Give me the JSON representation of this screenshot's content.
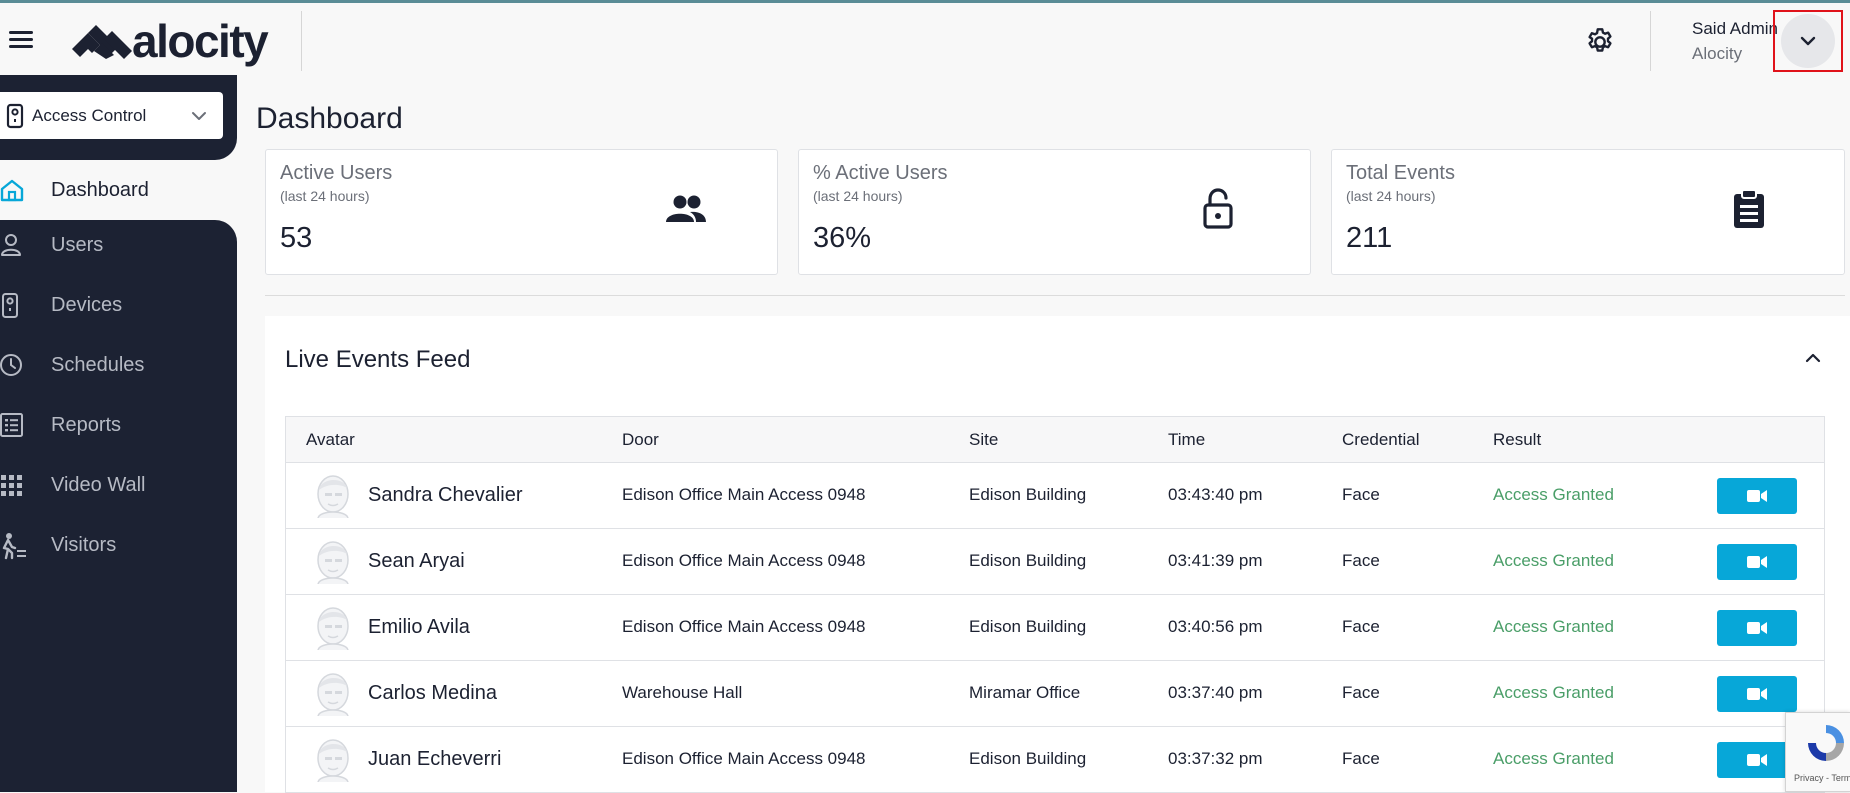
{
  "header": {
    "brand": "alocity",
    "user_name": "Said Admin",
    "user_org": "Alocity",
    "icons": [
      "menu-icon",
      "gear-icon",
      "chevron-down-icon"
    ]
  },
  "sidebar": {
    "module": "Access Control",
    "items": [
      {
        "label": "Dashboard",
        "icon": "home-icon",
        "active": true
      },
      {
        "label": "Users",
        "icon": "user-icon"
      },
      {
        "label": "Devices",
        "icon": "device-icon"
      },
      {
        "label": "Schedules",
        "icon": "clock-icon"
      },
      {
        "label": "Reports",
        "icon": "report-icon"
      },
      {
        "label": "Video Wall",
        "icon": "grid-icon"
      },
      {
        "label": "Visitors",
        "icon": "visitor-icon"
      }
    ]
  },
  "main": {
    "title": "Dashboard",
    "cards": [
      {
        "title": "Active Users",
        "subtitle": "(last 24 hours)",
        "value": "53",
        "icon": "users-icon"
      },
      {
        "title": "% Active Users",
        "subtitle": "(last 24 hours)",
        "value": "36%",
        "icon": "lock-open-icon"
      },
      {
        "title": "Total Events",
        "subtitle": "(last 24 hours)",
        "value": "211",
        "icon": "clipboard-icon"
      }
    ],
    "feed": {
      "title": "Live Events Feed",
      "columns": [
        "Avatar",
        "Door",
        "Site",
        "Time",
        "Credential",
        "Result"
      ],
      "rows": [
        {
          "name": "Sandra Chevalier",
          "door": "Edison Office Main Access 0948",
          "site": "Edison Building",
          "time": "03:43:40 pm",
          "credential": "Face",
          "result": "Access Granted"
        },
        {
          "name": "Sean Aryai",
          "door": "Edison Office Main Access 0948",
          "site": "Edison Building",
          "time": "03:41:39 pm",
          "credential": "Face",
          "result": "Access Granted"
        },
        {
          "name": "Emilio Avila",
          "door": "Edison Office Main Access 0948",
          "site": "Edison Building",
          "time": "03:40:56 pm",
          "credential": "Face",
          "result": "Access Granted"
        },
        {
          "name": "Carlos Medina",
          "door": "Warehouse Hall",
          "site": "Miramar Office",
          "time": "03:37:40 pm",
          "credential": "Face",
          "result": "Access Granted"
        },
        {
          "name": "Juan Echeverri",
          "door": "Edison Office Main Access 0948",
          "site": "Edison Building",
          "time": "03:37:32 pm",
          "credential": "Face",
          "result": "Access Granted"
        }
      ]
    }
  },
  "recaptcha": {
    "text": "Privacy - Terms"
  },
  "colors": {
    "sidebar": "#1c2233",
    "accent": "#07a7d8",
    "granted": "#4a9e68",
    "highlight": "#e0121a"
  }
}
